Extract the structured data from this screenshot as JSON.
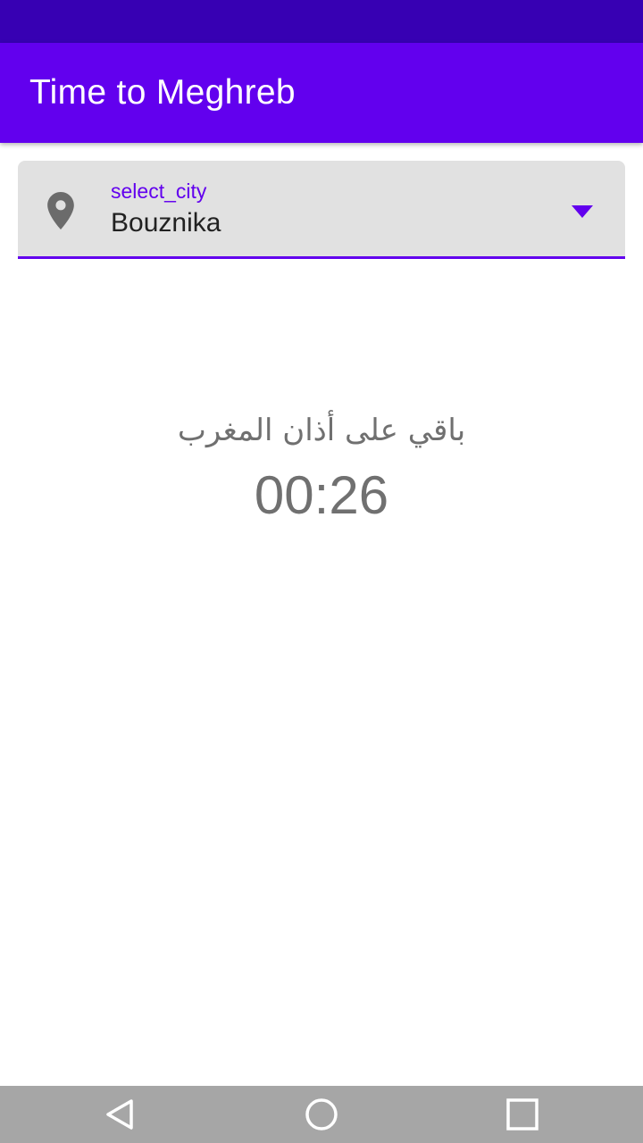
{
  "app": {
    "title": "Time to Meghreb"
  },
  "city_select": {
    "label": "select_city",
    "value": "Bouznika",
    "leading_icon": "location-pin-icon",
    "trailing_icon": "dropdown-arrow-icon"
  },
  "countdown": {
    "label": "باقي على أذان المغرب",
    "time": "00:26"
  },
  "navigation": {
    "buttons": [
      "back-icon",
      "home-icon",
      "recents-icon"
    ]
  },
  "colors": {
    "status_bar": "#3700b3",
    "app_bar": "#6200ee",
    "accent": "#6200ee",
    "field_bg": "#e1e1e1",
    "text_gray": "#707070",
    "nav_bar": "#a6a6a6"
  }
}
